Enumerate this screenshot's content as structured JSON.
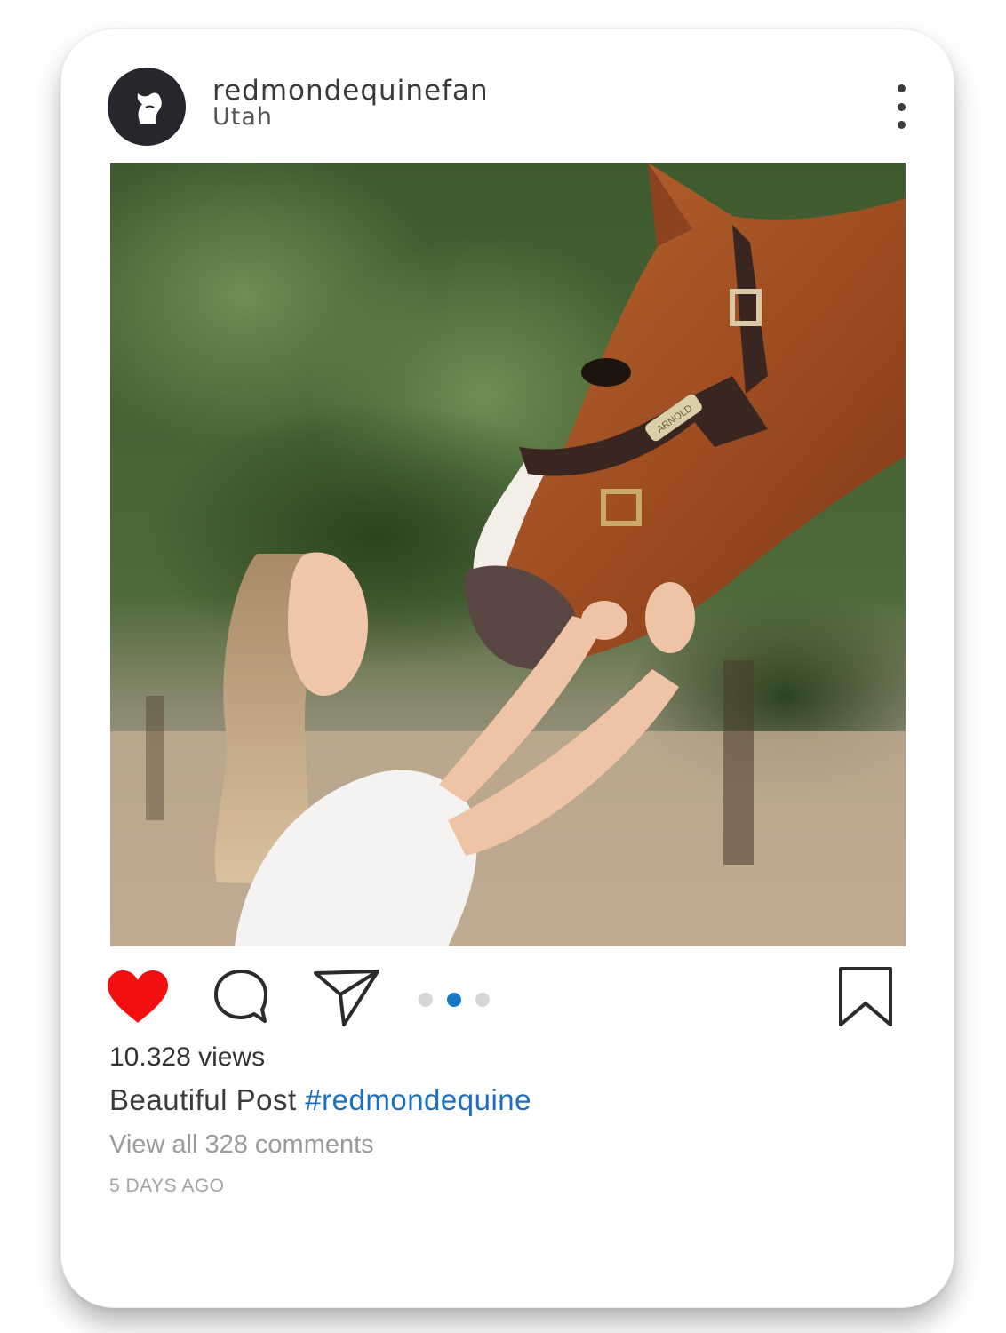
{
  "post": {
    "username": "redmondequinefan",
    "location": "Utah",
    "image_alt": "Woman smiling up at a chestnut horse wearing a leather halter",
    "halter_nameplate": "ARNOLD",
    "views_text": "10.328 views",
    "caption_text": "Beautiful Post",
    "caption_hashtag": "#redmondequine",
    "comments_link": "View all 328 comments",
    "timestamp": "5 DAYS AGO",
    "carousel": {
      "total": 3,
      "active_index": 1
    }
  },
  "icons": {
    "avatar": "horse-head-icon",
    "menu": "more-options-icon",
    "like": "heart-icon",
    "comment": "comment-icon",
    "share": "send-icon",
    "save": "bookmark-icon"
  },
  "colors": {
    "like_red": "#f20f0f",
    "hashtag_blue": "#1b6fc0",
    "active_dot": "#1677c7",
    "inactive_dot": "#d6d6d6",
    "avatar_bg": "#25272d"
  }
}
